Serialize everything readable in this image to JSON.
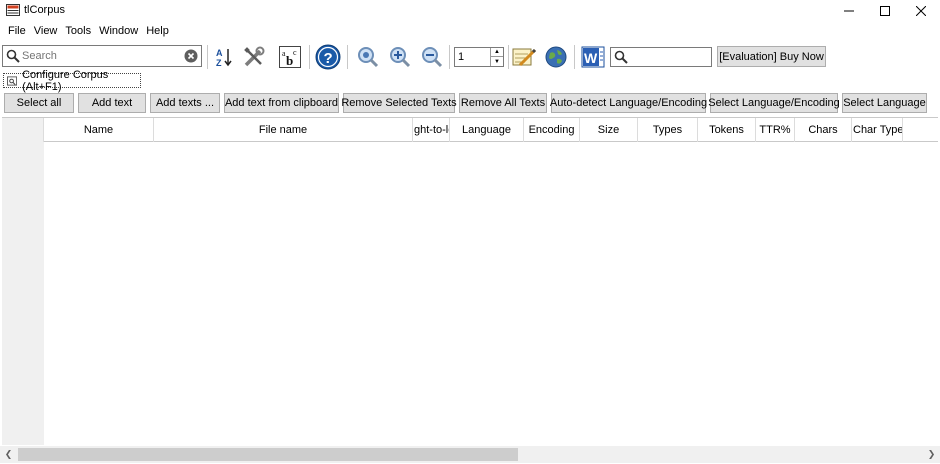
{
  "window": {
    "title": "tlCorpus",
    "controls": {
      "minimize": "minimize",
      "maximize": "maximize",
      "close": "close"
    }
  },
  "menu": [
    "File",
    "View",
    "Tools",
    "Window",
    "Help"
  ],
  "toolbar": {
    "search_placeholder": "Search",
    "page_number": "1",
    "word_search_value": "",
    "buy_now_label": "[Evaluation] Buy Now",
    "icons": [
      "sort-az-icon",
      "tools-icon",
      "spellcheck-icon",
      "help-icon",
      "zoom-icon",
      "zoom-in-icon",
      "zoom-out-icon",
      "notepad-icon",
      "globe-icon",
      "word-icon"
    ]
  },
  "configure_corpus": "Configure Corpus (Alt+F1)",
  "actions": [
    "Select all",
    "Add text",
    "Add texts ...",
    "Add text from clipboard",
    "Remove Selected Texts",
    "Remove All Texts",
    "Auto-detect Language/Encoding",
    "Select Language/Encoding",
    "Select Language"
  ],
  "columns": [
    "Name",
    "File name",
    "ght-to-le",
    "Language",
    "Encoding",
    "Size",
    "Types",
    "Tokens",
    "TTR%",
    "Chars",
    "Char Types"
  ],
  "rows": [],
  "colors": {
    "button_bg": "#e1e1e1",
    "grid_left": "#f0f0f0",
    "accent": "#1b5ea8"
  }
}
